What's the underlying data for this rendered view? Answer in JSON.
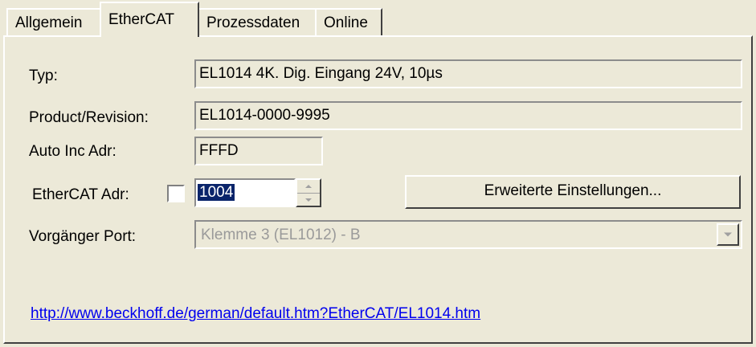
{
  "tabs": [
    {
      "label": "Allgemein",
      "active": false
    },
    {
      "label": "EtherCAT",
      "active": true
    },
    {
      "label": "Prozessdaten",
      "active": false
    },
    {
      "label": "Online",
      "active": false
    }
  ],
  "form": {
    "type_label": "Typ:",
    "type_value": "EL1014 4K. Dig. Eingang 24V, 10µs",
    "product_label": "Product/Revision:",
    "product_value": "EL1014-0000-9995",
    "autoinc_label": "Auto Inc Adr:",
    "autoinc_value": "FFFD",
    "ethercat_adr_label": "EtherCAT Adr:",
    "ethercat_adr_checked": false,
    "ethercat_adr_value": "1004",
    "advanced_button": "Erweiterte Einstellungen...",
    "prev_port_label": "Vorgänger Port:",
    "prev_port_value": "Klemme 3 (EL1012) - B"
  },
  "link": "http://www.beckhoff.de/german/default.htm?EtherCAT/EL1014.htm",
  "icons": {
    "spinner_up": "spin-up-arrow-icon",
    "spinner_down": "spin-down-arrow-icon",
    "dropdown": "chevron-down-icon"
  },
  "colors": {
    "background": "#ece9d8",
    "selection": "#0a246a",
    "link": "#0000ee",
    "disabled_text": "#9a9a9a"
  }
}
